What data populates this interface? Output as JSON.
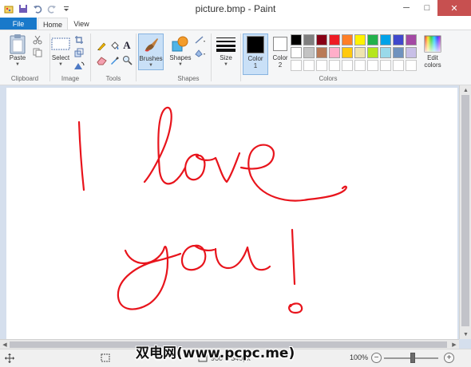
{
  "window": {
    "title": "picture.bmp - Paint",
    "minimize": "─",
    "maximize": "□",
    "close": "✕"
  },
  "tabs": {
    "file": "File",
    "home": "Home",
    "view": "View"
  },
  "ribbon": {
    "clipboard": {
      "paste": "Paste",
      "group_label": "Clipboard"
    },
    "image": {
      "select": "Select",
      "group_label": "Image"
    },
    "tools": {
      "group_label": "Tools"
    },
    "brushes": {
      "label": "Brushes"
    },
    "shapes": {
      "label": "Shapes",
      "group_label": "Shapes"
    },
    "size": {
      "label": "Size"
    },
    "colors": {
      "color1_label": "Color",
      "color1_num": "1",
      "color2_label": "Color",
      "color2_num": "2",
      "edit_label_1": "Edit",
      "edit_label_2": "colors",
      "group_label": "Colors",
      "color1_value": "#000000",
      "color2_value": "#ffffff",
      "palette_row1": [
        "#000000",
        "#7f7f7f",
        "#880015",
        "#ed1c24",
        "#ff7f27",
        "#fff200",
        "#22b14c",
        "#00a2e8",
        "#3f48cc",
        "#a349a4"
      ],
      "palette_row2": [
        "#ffffff",
        "#c3c3c3",
        "#b97a57",
        "#ffaec9",
        "#ffc90e",
        "#efe4b0",
        "#b5e61d",
        "#99d9ea",
        "#7092be",
        "#c8bfe7"
      ]
    }
  },
  "canvas": {
    "background": "#ffffff",
    "ink_color": "#e8141c"
  },
  "statusbar": {
    "image_size": "960 × 540px",
    "zoom": "100%"
  },
  "watermark": "双电网(www.pcpc.me)"
}
